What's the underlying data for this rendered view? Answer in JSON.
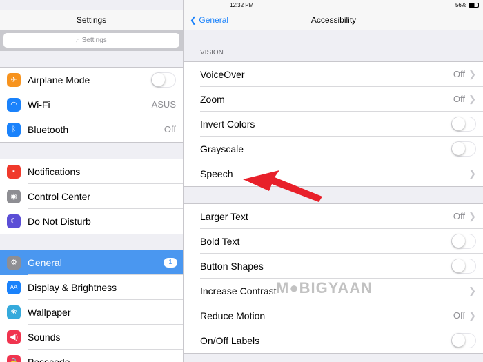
{
  "status": {
    "device": "iPad",
    "time": "12:32 PM",
    "battery": "56%"
  },
  "left": {
    "title": "Settings",
    "search_placeholder": "Settings",
    "group1": [
      {
        "label": "Airplane Mode",
        "icon": "airplane-icon",
        "color": "#f7931e",
        "control": "toggle-off"
      },
      {
        "label": "Wi-Fi",
        "icon": "wifi-icon",
        "color": "#1a82fb",
        "value": "ASUS"
      },
      {
        "label": "Bluetooth",
        "icon": "bluetooth-icon",
        "color": "#1a82fb",
        "value": "Off"
      }
    ],
    "group2": [
      {
        "label": "Notifications",
        "icon": "notifications-icon",
        "color": "#f0392b"
      },
      {
        "label": "Control Center",
        "icon": "control-center-icon",
        "color": "#8e8e93"
      },
      {
        "label": "Do Not Disturb",
        "icon": "moon-icon",
        "color": "#5b4ed6"
      }
    ],
    "group3": [
      {
        "label": "General",
        "icon": "gear-icon",
        "color": "#8e8e93",
        "badge": "1",
        "selected": true
      },
      {
        "label": "Display & Brightness",
        "icon": "display-icon",
        "color": "#1a82fb",
        "glyph": "AA"
      },
      {
        "label": "Wallpaper",
        "icon": "wallpaper-icon",
        "color": "#35aadc"
      },
      {
        "label": "Sounds",
        "icon": "sounds-icon",
        "color": "#f0344f"
      },
      {
        "label": "Passcode",
        "icon": "lock-icon",
        "color": "#f0344f"
      }
    ]
  },
  "right": {
    "back": "General",
    "title": "Accessibility",
    "section": "VISION",
    "group1": [
      {
        "label": "VoiceOver",
        "value": "Off",
        "chevron": true
      },
      {
        "label": "Zoom",
        "value": "Off",
        "chevron": true
      },
      {
        "label": "Invert Colors",
        "toggle": false
      },
      {
        "label": "Grayscale",
        "toggle": false
      },
      {
        "label": "Speech",
        "chevron": true
      }
    ],
    "group2": [
      {
        "label": "Larger Text",
        "value": "Off",
        "chevron": true
      },
      {
        "label": "Bold Text",
        "toggle": false
      },
      {
        "label": "Button Shapes",
        "toggle": false
      },
      {
        "label": "Increase Contrast",
        "chevron": true
      },
      {
        "label": "Reduce Motion",
        "value": "Off",
        "chevron": true
      },
      {
        "label": "On/Off Labels",
        "toggle": false
      }
    ]
  },
  "watermark": "MOBIGYAAN",
  "accent": "#4a97f0",
  "arrow_color": "#e8202a"
}
